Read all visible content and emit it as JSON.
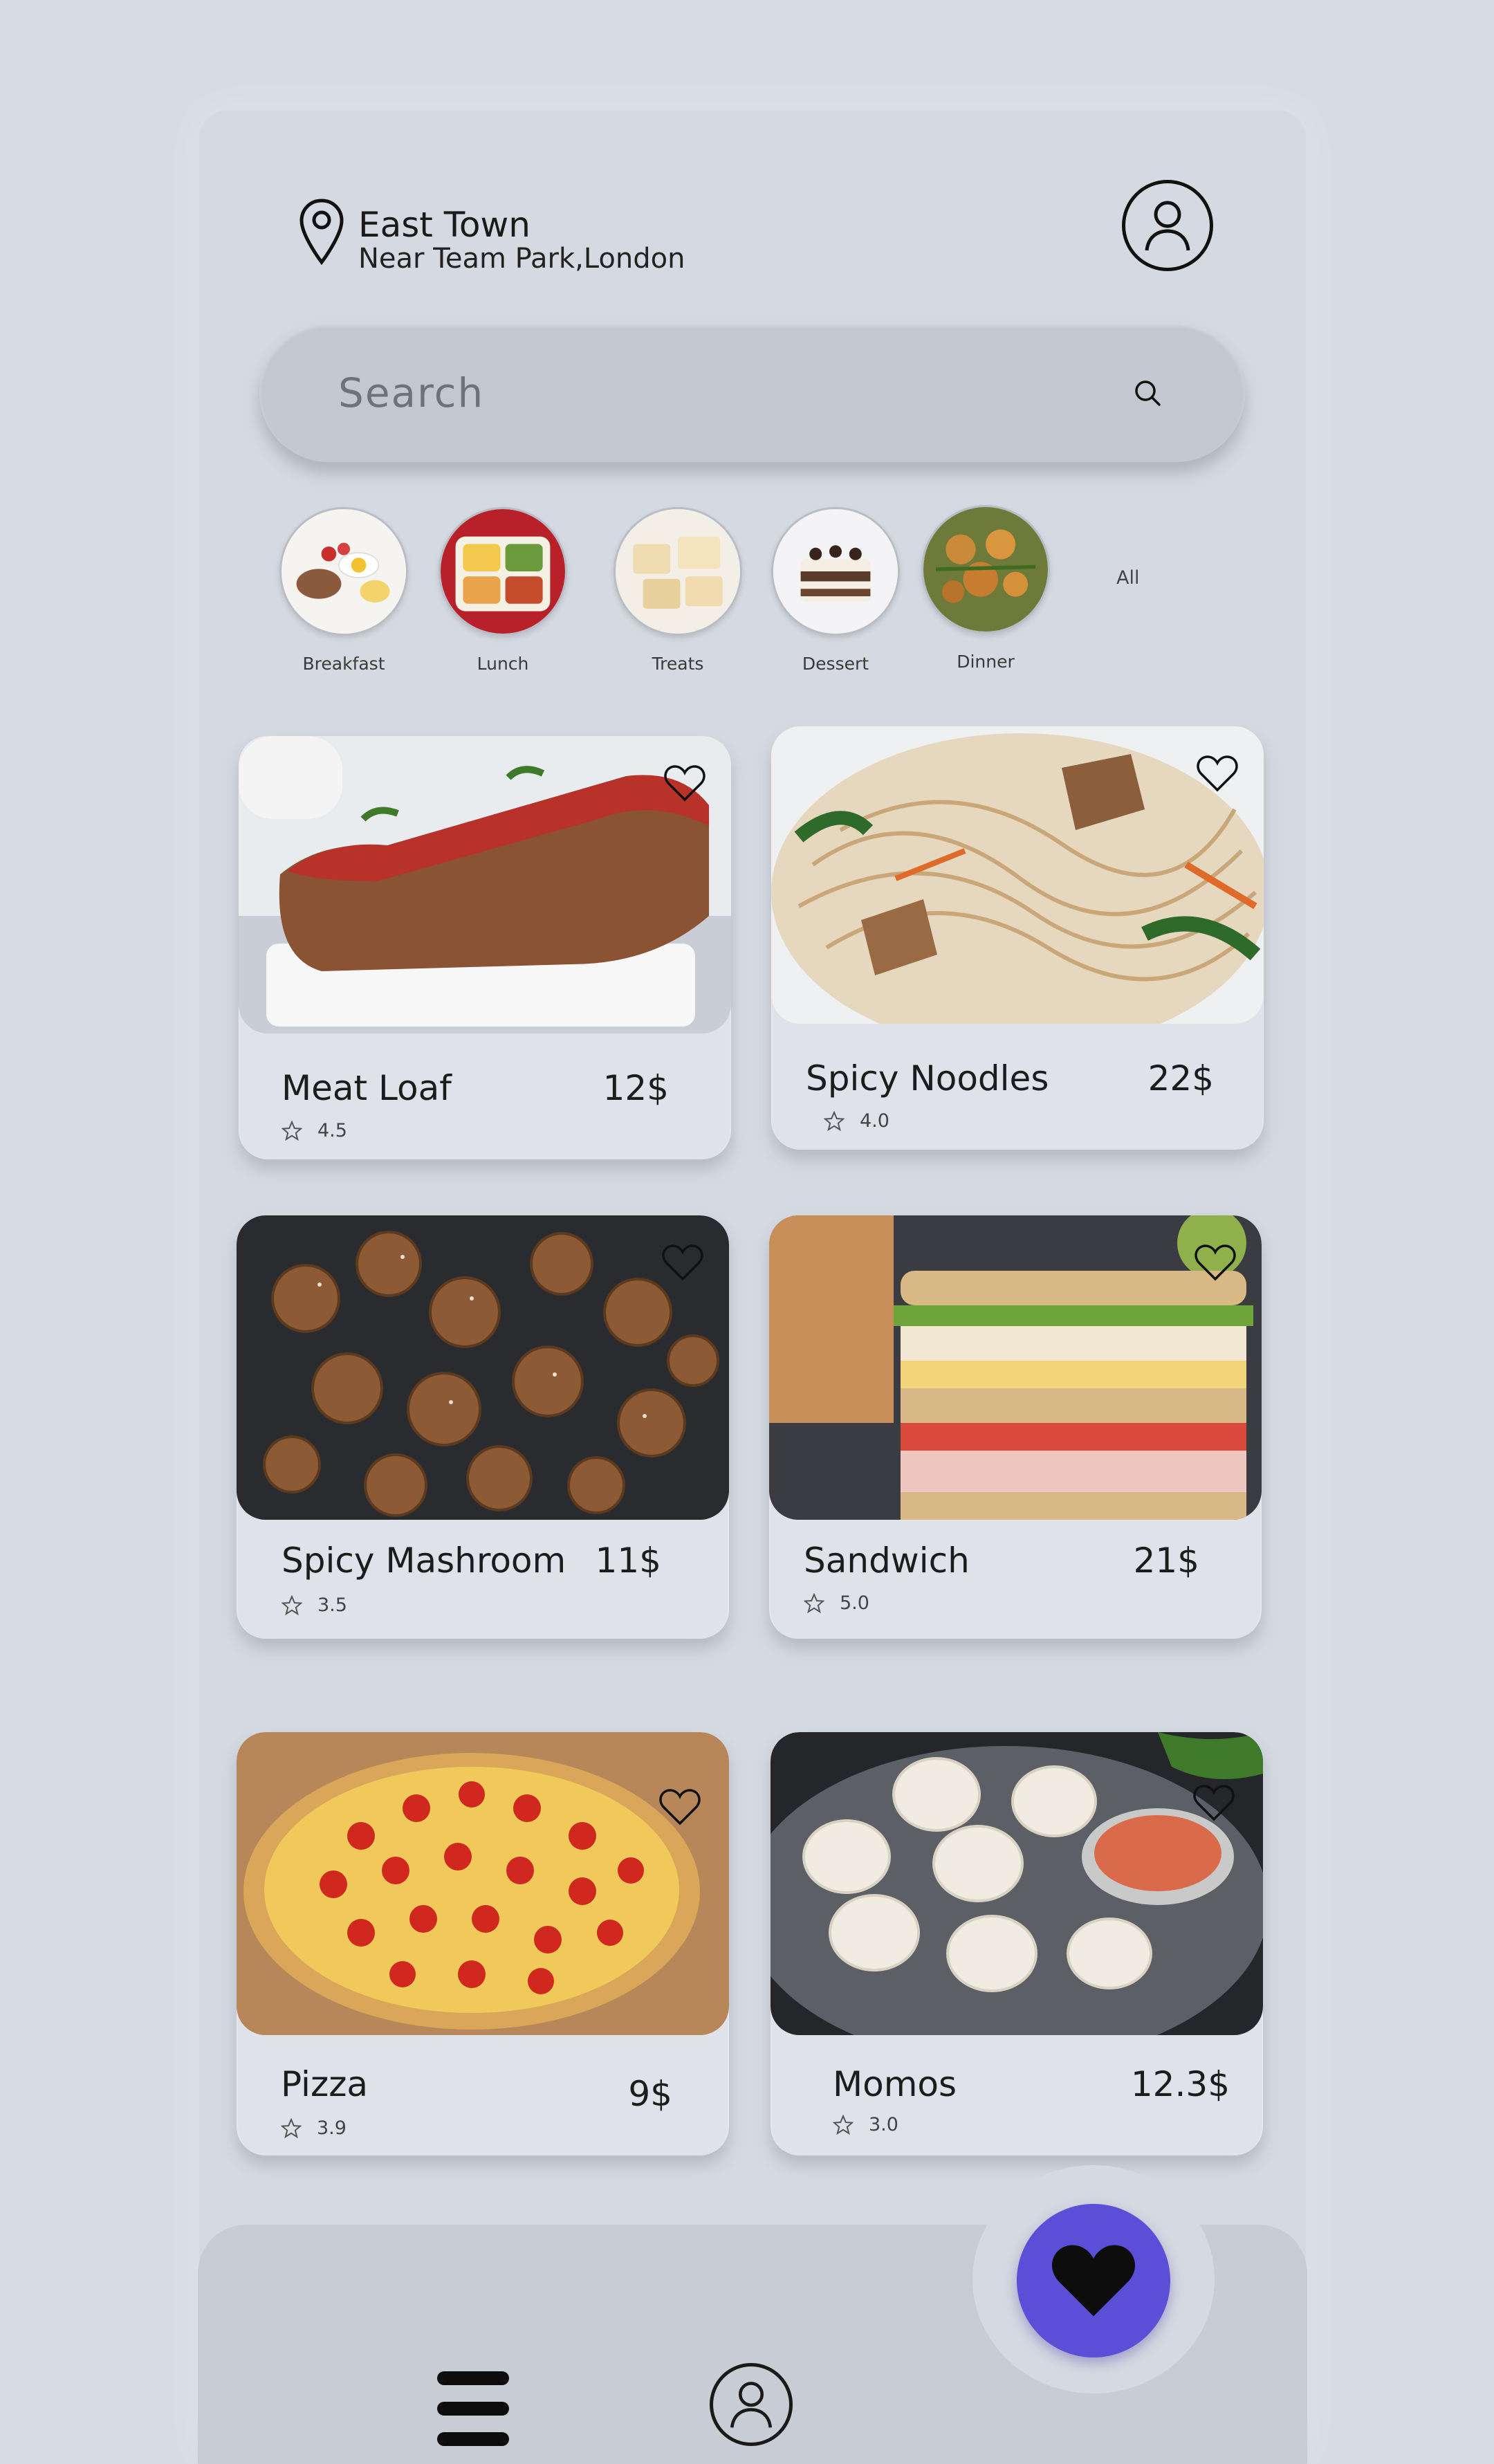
{
  "location": {
    "city": "East Town",
    "address": "Near Team Park,London"
  },
  "search": {
    "placeholder": "Search"
  },
  "categories": [
    {
      "label": "Breakfast"
    },
    {
      "label": "Lunch"
    },
    {
      "label": "Treats"
    },
    {
      "label": "Dessert"
    },
    {
      "label": "Dinner"
    }
  ],
  "categories_all": "All",
  "dishes": [
    {
      "name": "Meat Loaf",
      "price": "12$",
      "rating": "4.5"
    },
    {
      "name": "Spicy Noodles",
      "price": "22$",
      "rating": "4.0"
    },
    {
      "name": "Spicy Mashroom",
      "price": "11$",
      "rating": "3.5"
    },
    {
      "name": "Sandwich",
      "price": "21$",
      "rating": "5.0"
    },
    {
      "name": "Pizza",
      "price": "9$",
      "rating": "3.9"
    },
    {
      "name": "Momos",
      "price": "12.3$",
      "rating": "3.0"
    }
  ],
  "icons": {
    "location": "map-pin-icon",
    "profile": "user-circle-icon",
    "search": "search-icon",
    "favorite": "heart-icon",
    "menu": "hamburger-menu-icon",
    "rating": "star-outline-icon"
  },
  "colors": {
    "background": "#d7dbe3",
    "card": "#dfe2e9",
    "search_bar": "#c3c7cf",
    "nav_bar": "#c8ccd4",
    "accent": "#5a4fd6"
  }
}
